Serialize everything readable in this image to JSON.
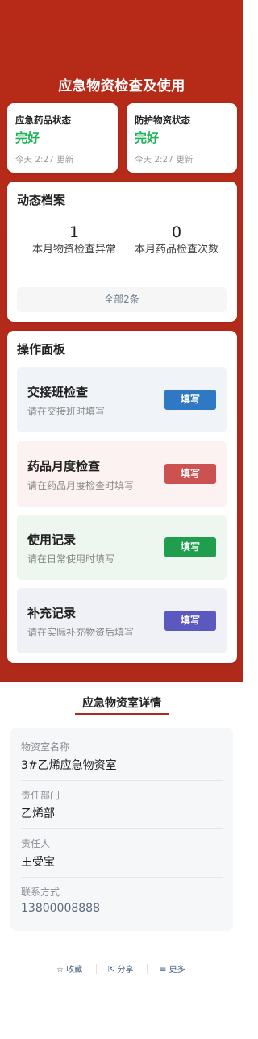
{
  "header": {
    "title": "应急物资检查及使用"
  },
  "status_cards": [
    {
      "title": "应急药品状态",
      "value": "完好",
      "time": "今天 2:27 更新"
    },
    {
      "title": "防护物资状态",
      "value": "完好",
      "time": "今天 2:27 更新"
    }
  ],
  "archive": {
    "title": "动态档案",
    "stats": [
      {
        "value": "1",
        "label": "本月物资检查异常"
      },
      {
        "value": "0",
        "label": "本月药品检查次数"
      }
    ],
    "all_label": "全部2条"
  },
  "panel": {
    "title": "操作面板",
    "items": [
      {
        "title": "交接班检查",
        "desc": "请在交接班时填写",
        "button": "填写",
        "color": "#2f78c4"
      },
      {
        "title": "药品月度检查",
        "desc": "请在药品月度检查时填写",
        "button": "填写",
        "color": "#cc5151"
      },
      {
        "title": "使用记录",
        "desc": "请在日常使用时填写",
        "button": "填写",
        "color": "#1f9e4d"
      },
      {
        "title": "补充记录",
        "desc": "请在实际补充物资后填写",
        "button": "填写",
        "color": "#5b58c0"
      }
    ]
  },
  "detail": {
    "tab": "应急物资室详情",
    "fields": [
      {
        "label": "物资室名称",
        "value": "3#乙烯应急物资室"
      },
      {
        "label": "责任部门",
        "value": "乙烯部"
      },
      {
        "label": "责任人",
        "value": "王受宝"
      },
      {
        "label": "联系方式",
        "value": "13800008888"
      }
    ]
  },
  "footer": {
    "favorite": "☆ 收藏",
    "share": "⇱ 分享",
    "more": "≡ 更多"
  }
}
